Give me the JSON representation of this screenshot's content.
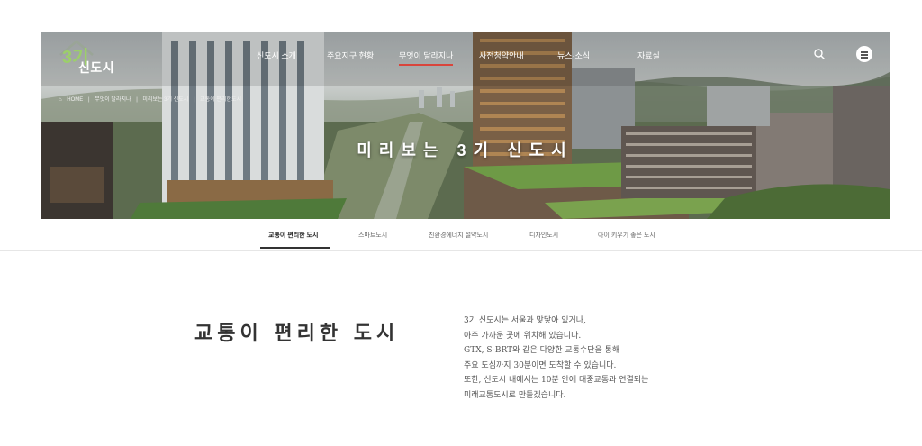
{
  "header": {
    "logo_mark": "3기",
    "logo_name": "신도시",
    "nav": [
      {
        "label": "신도시 소개"
      },
      {
        "label": "주요지구 현황"
      },
      {
        "label": "무엇이 달라지나"
      },
      {
        "label": "사전청약안내"
      },
      {
        "label": "뉴스·소식"
      },
      {
        "label": "자료실"
      }
    ],
    "active_nav": "무엇이 달라지나"
  },
  "breadcrumb": [
    "HOME",
    "무엇이 달라지나",
    "미리보는 3기 신도시",
    "교통이 편리한도시"
  ],
  "hero": {
    "title": "미리보는 3기 신도시"
  },
  "tabs": [
    {
      "label": "교통이 편리한 도시",
      "active": true
    },
    {
      "label": "스마트도시",
      "active": false
    },
    {
      "label": "친환경에너지 절약도시",
      "active": false
    },
    {
      "label": "디자인도시",
      "active": false
    },
    {
      "label": "아이 키우기 좋은 도시",
      "active": false
    }
  ],
  "content": {
    "title": "교통이 편리한 도시",
    "lines": [
      "3기 신도시는 서울과 맞닿아 있거나,",
      "아주 가까운 곳에 위치해 있습니다.",
      "GTX, S-BRT와 같은 다양한 교통수단을 통해",
      "주요 도심까지 30분이면 도착할 수 있습니다.",
      "또한, 신도시 내에서는 10분 안에 대중교통과 연결되는",
      "미래교통도시로 만들겠습니다."
    ]
  },
  "colors": {
    "accent": "#d9453b",
    "logo_green": "#9ccf6a"
  }
}
